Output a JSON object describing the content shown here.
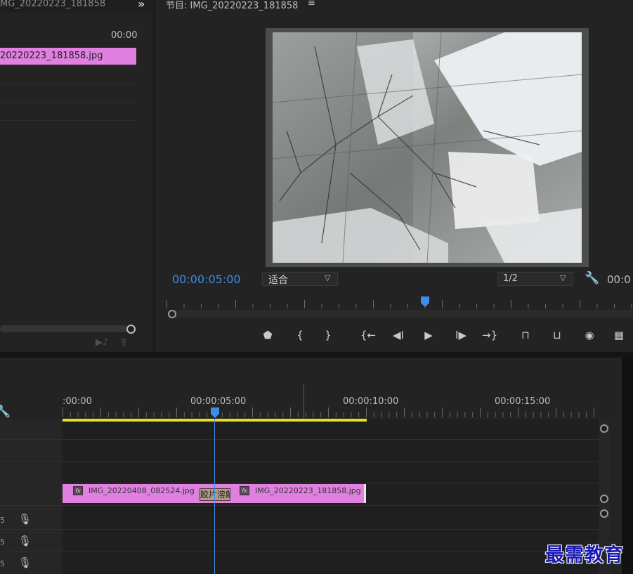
{
  "source_panel": {
    "title": "MG_20220223_181858",
    "expand_icon": "double-chevron-right-icon",
    "timecode": "00:00",
    "clip_label": "20220223_181858.jpg"
  },
  "program_monitor": {
    "title": "节目: IMG_20220223_181858",
    "menu_icon": "≡",
    "timecode": "00:00:05:00",
    "fit_label": "适合",
    "resolution_label": "1/2",
    "right_timecode": "00:0",
    "controls": [
      {
        "name": "add-marker-button",
        "glyph": "⬟"
      },
      {
        "name": "mark-in-button",
        "glyph": "{"
      },
      {
        "name": "mark-out-button",
        "glyph": "}"
      },
      {
        "name": "go-to-in-button",
        "glyph": "{←"
      },
      {
        "name": "step-back-button",
        "glyph": "◀I"
      },
      {
        "name": "play-button",
        "glyph": "▶"
      },
      {
        "name": "step-forward-button",
        "glyph": "I▶"
      },
      {
        "name": "go-to-out-button",
        "glyph": "→}"
      },
      {
        "name": "lift-button",
        "glyph": "⊓"
      },
      {
        "name": "extract-button",
        "glyph": "⊔"
      },
      {
        "name": "export-frame-button",
        "glyph": "◉"
      },
      {
        "name": "compare-view-button",
        "glyph": "▦"
      }
    ]
  },
  "timeline": {
    "timecodes": [
      ":00:00",
      "00:00:05:00",
      "00:00:10:00",
      "00:00:15:00"
    ],
    "clips": [
      {
        "label": "IMG_20220408_082524.jpg",
        "fx": "fx"
      },
      {
        "label": "IMG_20220223_181858.jpg",
        "fx": "fx"
      }
    ],
    "transition_label": "胶片溶解",
    "audio_tracks": [
      "5",
      "5",
      "5"
    ]
  },
  "watermark": "最需教育",
  "colors": {
    "accent_blue": "#3c8fe8",
    "clip_pink": "#e080e0",
    "work_area_yellow": "#e8e020",
    "panel_bg": "#232323"
  }
}
